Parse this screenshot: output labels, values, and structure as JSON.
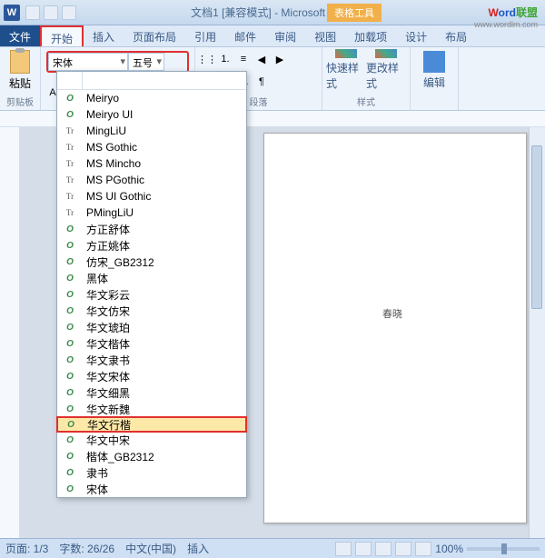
{
  "title": "文档1 [兼容模式] - Microsoft Word",
  "table_tools": "表格工具",
  "brand": {
    "w": "W",
    "ord": "ord",
    "lian": "联盟"
  },
  "url": "www.wordlm.com",
  "tabs": {
    "file": "文件",
    "home": "开始",
    "insert": "插入",
    "layout": "页面布局",
    "ref": "引用",
    "mail": "邮件",
    "review": "审阅",
    "view": "视图",
    "addin": "加载项",
    "design": "设计",
    "layout2": "布局"
  },
  "ribbon": {
    "paste": "粘贴",
    "clipboard": "剪贴板",
    "font_current": "宋体",
    "size_current": "五号",
    "paragraph": "段落",
    "quickstyle": "快速样式",
    "changestyle": "更改样式",
    "styles": "样式",
    "edit": "编辑"
  },
  "fontlist": [
    {
      "icon": "o",
      "label": "Meiryo"
    },
    {
      "icon": "o",
      "label": "Meiryo UI"
    },
    {
      "icon": "t",
      "label": "MingLiU"
    },
    {
      "icon": "t",
      "label": "MS Gothic"
    },
    {
      "icon": "t",
      "label": "MS Mincho"
    },
    {
      "icon": "t",
      "label": "MS PGothic"
    },
    {
      "icon": "t",
      "label": "MS UI Gothic"
    },
    {
      "icon": "t",
      "label": "PMingLiU"
    },
    {
      "icon": "o",
      "label": "方正舒体"
    },
    {
      "icon": "o",
      "label": "方正姚体"
    },
    {
      "icon": "o",
      "label": "仿宋_GB2312"
    },
    {
      "icon": "o",
      "label": "黑体"
    },
    {
      "icon": "o",
      "label": "华文彩云"
    },
    {
      "icon": "o",
      "label": "华文仿宋"
    },
    {
      "icon": "o",
      "label": "华文琥珀"
    },
    {
      "icon": "o",
      "label": "华文楷体"
    },
    {
      "icon": "o",
      "label": "华文隶书"
    },
    {
      "icon": "o",
      "label": "华文宋体"
    },
    {
      "icon": "o",
      "label": "华文细黑"
    },
    {
      "icon": "o",
      "label": "华文新魏"
    },
    {
      "icon": "o",
      "label": "华文行楷",
      "hl": true
    },
    {
      "icon": "o",
      "label": "华文中宋"
    },
    {
      "icon": "o",
      "label": "楷体_GB2312"
    },
    {
      "icon": "o",
      "label": "隶书"
    },
    {
      "icon": "o",
      "label": "宋体"
    }
  ],
  "doc_text": "春晓",
  "status": {
    "page": "页面: 1/3",
    "words": "字数: 26/26",
    "lang": "中文(中国)",
    "mode": "插入",
    "zoom": "100%"
  }
}
